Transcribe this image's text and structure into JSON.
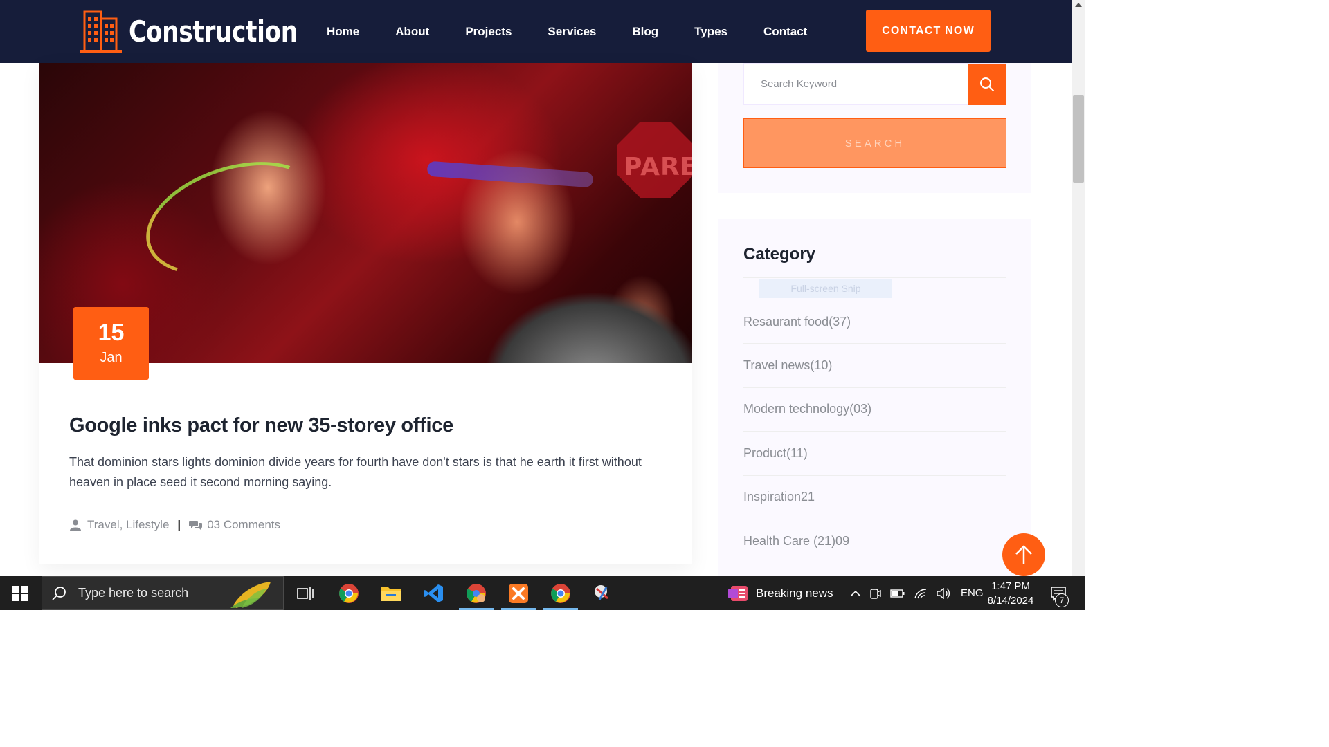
{
  "brand": {
    "name": "Construction"
  },
  "nav": {
    "items": [
      {
        "label": "Home"
      },
      {
        "label": "About"
      },
      {
        "label": "Projects"
      },
      {
        "label": "Services"
      },
      {
        "label": "Blog"
      },
      {
        "label": "Types"
      },
      {
        "label": "Contact"
      }
    ],
    "cta_label": "CONTACT NOW"
  },
  "post": {
    "date_day": "15",
    "date_month": "Jan",
    "image_sign_text": "PARE",
    "title": "Google inks pact for new 35-storey office",
    "excerpt": "That dominion stars lights dominion divide years for fourth have don't stars is that he earth it first without heaven in place seed it second morning saying.",
    "tags": "Travel, Lifestyle",
    "separator": "|",
    "comments": "03 Comments"
  },
  "sidebar": {
    "search": {
      "placeholder": "Search Keyword",
      "button_label": "SEARCH"
    },
    "category": {
      "title": "Category",
      "overlay_text": "Full-screen Snip",
      "items": [
        {
          "label": "Resaurant food(37)"
        },
        {
          "label": "Travel news(10)"
        },
        {
          "label": "Modern technology(03)"
        },
        {
          "label": "Product(11)"
        },
        {
          "label": "Inspiration21"
        },
        {
          "label": "Health Care (21)09"
        }
      ]
    }
  },
  "taskbar": {
    "search_placeholder": "Type here to search",
    "apps": [
      "task-view",
      "chrome",
      "file-explorer",
      "vs-code",
      "chrome-profile",
      "xampp",
      "chrome",
      "snipping-tool"
    ],
    "news_label": "Breaking news",
    "language": "ENG",
    "time": "1:47 PM",
    "date": "8/14/2024",
    "notification_count": "7"
  },
  "colors": {
    "header_bg": "#161d3a",
    "accent": "#ff5e13",
    "sidebar_bg": "#fbf9ff",
    "taskbar_bg": "#1f1f1f"
  }
}
